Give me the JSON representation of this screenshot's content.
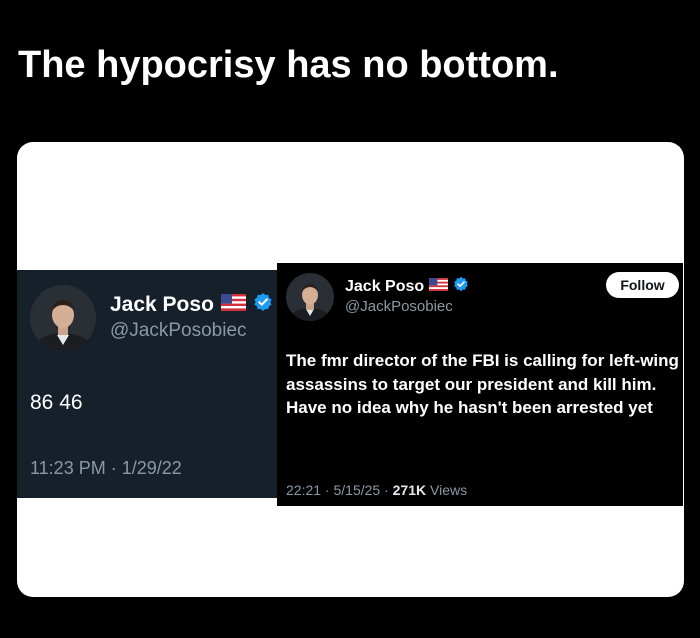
{
  "headline": "The hypocrisy has no bottom.",
  "colors": {
    "page_bg": "#000000",
    "card_bg": "#ffffff",
    "dim_tweet_bg": "#15202b",
    "black_tweet_bg": "#000000",
    "verified_blue": "#1d9bf0",
    "secondary_text": "#8b98a5"
  },
  "tweet_old": {
    "name": "Jack Poso",
    "flag_icon": "us-flag-icon",
    "verified_icon": "verified-badge-icon",
    "handle": "@JackPosobiec",
    "text": "86 46",
    "timestamp": "11:23 PM · 1/29/22"
  },
  "tweet_new": {
    "name": "Jack Poso",
    "flag_icon": "us-flag-icon",
    "verified_icon": "verified-badge-icon",
    "handle": "@JackPosobiec",
    "follow_label": "Follow",
    "text": "The fmr director of the FBI is calling for left-wing assassins to target our president and kill him. Have no idea why he hasn't been arrested yet",
    "timestamp": "22:21 · 5/15/25 · ",
    "views_count": "271K",
    "views_label": " Views"
  }
}
